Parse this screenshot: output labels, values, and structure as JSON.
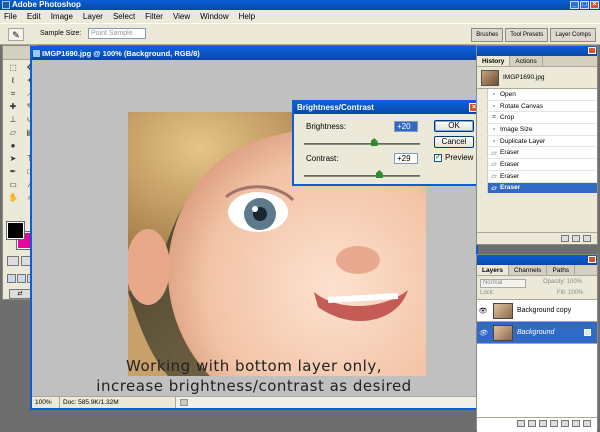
{
  "app": {
    "title": "Adobe Photoshop"
  },
  "menu": [
    "File",
    "Edit",
    "Image",
    "Layer",
    "Select",
    "Filter",
    "View",
    "Window",
    "Help"
  ],
  "options_bar": {
    "tool_icon": "eyedropper-icon",
    "label": "Sample Size:",
    "value": "Point Sample"
  },
  "palette_well": [
    "Brushes",
    "Tool Presets",
    "Layer Comps"
  ],
  "toolbox": {
    "tools": [
      "marquee",
      "move",
      "lasso",
      "magic-wand",
      "crop",
      "slice",
      "healing",
      "brush",
      "stamp",
      "history-brush",
      "eraser",
      "gradient",
      "blur",
      "dodge",
      "path-select",
      "type",
      "pen",
      "shape",
      "notes",
      "eyedropper",
      "hand",
      "zoom"
    ],
    "colors": {
      "foreground": "#000000",
      "background": "#e3079e"
    }
  },
  "document": {
    "title": "IMGP1690.jpg @ 100% (Background, RGB/8)",
    "caption_line1": "Working with bottom layer only,",
    "caption_line2": "increase brightness/contrast as desired",
    "status": {
      "zoom": "100%",
      "doc": "Doc: 585.9K/1.32M"
    }
  },
  "dialog": {
    "title": "Brightness/Contrast",
    "brightness_label": "Brightness:",
    "brightness_value": "+20",
    "brightness_level": 0.6,
    "contrast_label": "Contrast:",
    "contrast_value": "+29",
    "contrast_level": 0.645,
    "ok_label": "OK",
    "cancel_label": "Cancel",
    "preview_label": "Preview",
    "preview_checked": true
  },
  "history": {
    "tabs": [
      "History",
      "Actions"
    ],
    "snapshot": "IMGP1690.jpg",
    "items": [
      {
        "label": "Open",
        "icon": "doc-icon"
      },
      {
        "label": "Rotate Canvas",
        "icon": "doc-icon"
      },
      {
        "label": "Crop",
        "icon": "crop-icon"
      },
      {
        "label": "Image Size",
        "icon": "doc-icon"
      },
      {
        "label": "Duplicate Layer",
        "icon": "doc-icon"
      },
      {
        "label": "Eraser",
        "icon": "eraser-icon"
      },
      {
        "label": "Eraser",
        "icon": "eraser-icon"
      },
      {
        "label": "Eraser",
        "icon": "eraser-icon"
      },
      {
        "label": "Eraser",
        "icon": "eraser-icon"
      }
    ],
    "selected_index": 8
  },
  "layers": {
    "tabs": [
      "Layers",
      "Channels",
      "Paths"
    ],
    "blend_mode": "Normal",
    "opacity_label": "Opacity:",
    "opacity": "100%",
    "lock_label": "Lock:",
    "fill_label": "Fill:",
    "fill": "100%",
    "items": [
      {
        "name": "Background copy",
        "selected": false
      },
      {
        "name": "Background",
        "selected": true
      }
    ]
  }
}
